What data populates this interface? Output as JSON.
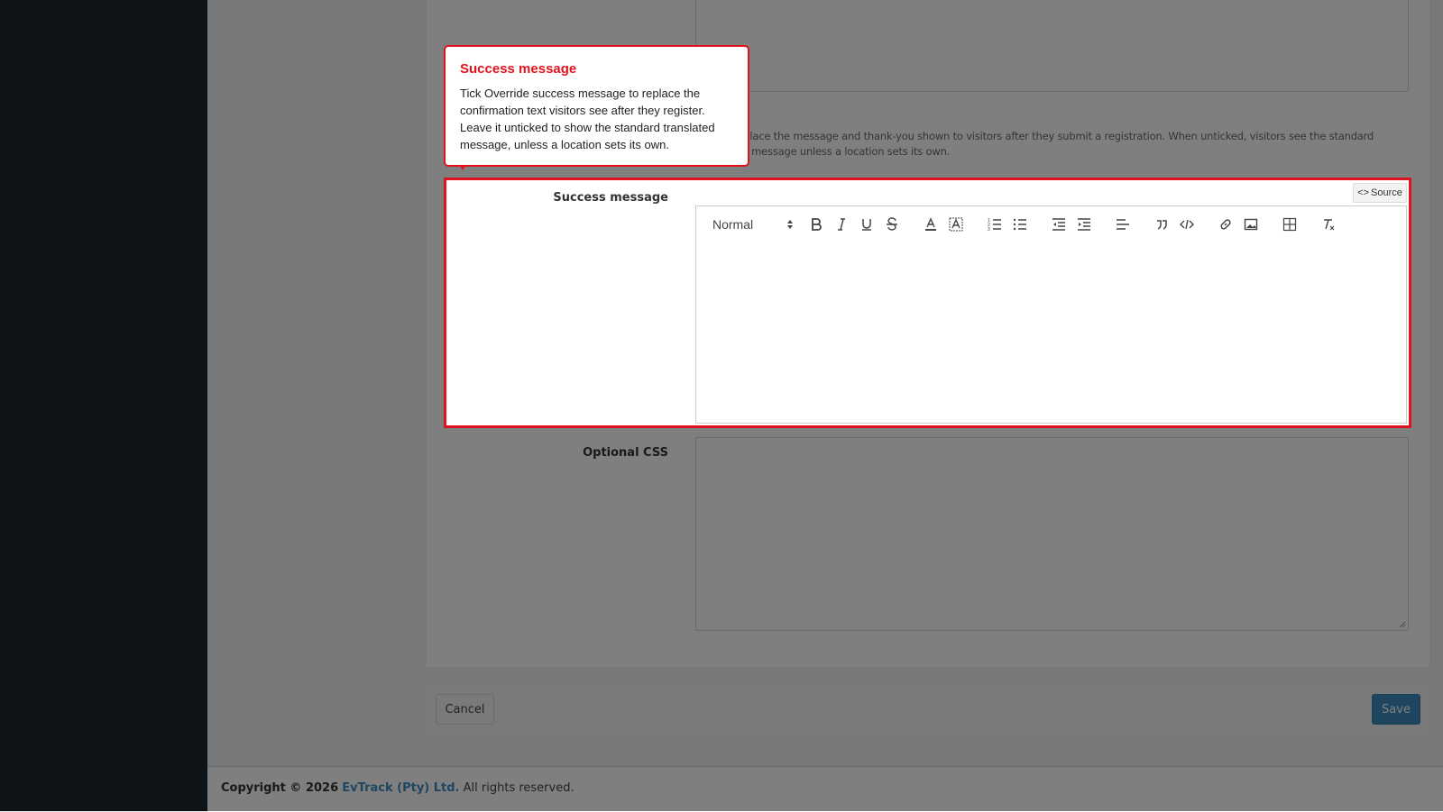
{
  "form": {
    "help_text": "Tick to replace the message and thank-you shown to visitors after they submit a registration. When unticked, visitors see the standard translated message unless a location sets its own.",
    "success_message_label": "Success message",
    "optional_css_label": "Optional CSS",
    "source_button_label": "Source",
    "editor": {
      "format_select_value": "Normal",
      "toolbar_icons": [
        "bold-icon",
        "italic-icon",
        "underline-icon",
        "strike-icon",
        "text-color-icon",
        "background-color-icon",
        "ordered-list-icon",
        "bullet-list-icon",
        "outdent-icon",
        "indent-icon",
        "align-left-icon",
        "blockquote-icon",
        "code-block-icon",
        "link-icon",
        "image-icon",
        "table-icon",
        "clear-format-icon"
      ]
    }
  },
  "actions": {
    "cancel_label": "Cancel",
    "save_label": "Save"
  },
  "footer": {
    "copyright": "Copyright © 2026",
    "company": "EvTrack (Pty) Ltd.",
    "rights": "All rights reserved."
  },
  "tour": {
    "title": "Success message",
    "body": "Tick Override success message to replace the confirmation text visitors see after they register. Leave it unticked to show the standard translated message, unless a location sets its own."
  },
  "colors": {
    "highlight": "#e0141e",
    "primary": "#3c8dbc",
    "sidebar": "#1b262f"
  }
}
